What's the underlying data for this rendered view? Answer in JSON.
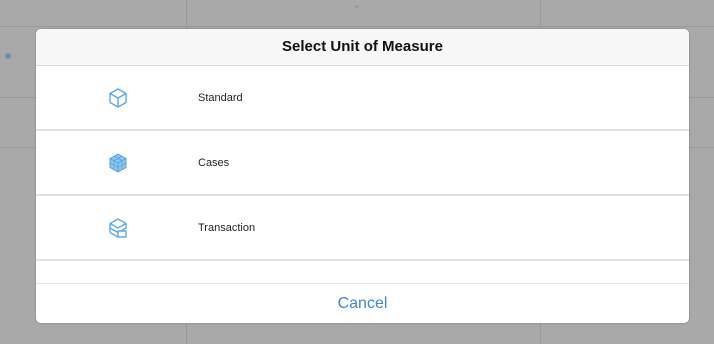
{
  "modal": {
    "title": "Select Unit of Measure",
    "options": [
      {
        "label": "Standard",
        "icon": "cube-outline-icon"
      },
      {
        "label": "Cases",
        "icon": "cube-grid-icon"
      },
      {
        "label": "Transaction",
        "icon": "cube-transaction-icon"
      }
    ],
    "cancel_label": "Cancel"
  },
  "colors": {
    "accent": "#3f86c5",
    "icon": "#5aa9e6",
    "overlay": "#a9a9a9"
  }
}
